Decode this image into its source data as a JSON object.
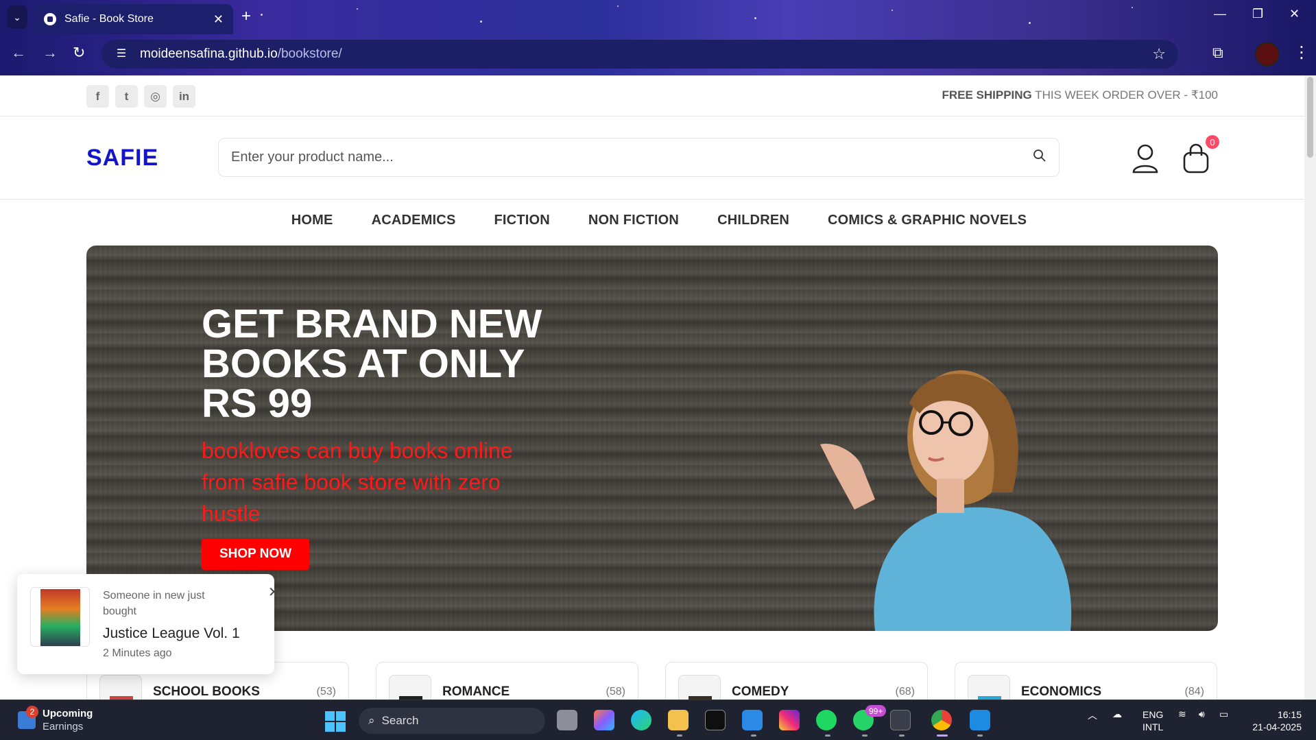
{
  "browser": {
    "tab_title": "Safie - Book Store",
    "url_host": "moideensafina.github.io",
    "url_path": "/bookstore/"
  },
  "topbar": {
    "socials": [
      "facebook-icon",
      "twitter-icon",
      "instagram-icon",
      "linkedin-icon"
    ],
    "shipping_bold": "FREE SHIPPING",
    "shipping_rest": " THIS WEEK ORDER OVER - ₹100"
  },
  "header": {
    "logo": "SAFIE",
    "search_placeholder": "Enter your product name...",
    "cart_count": "0"
  },
  "nav": {
    "items": [
      "HOME",
      "ACADEMICS",
      "FICTION",
      "NON FICTION",
      "CHILDREN",
      "COMICS & GRAPHIC NOVELS"
    ]
  },
  "hero": {
    "title": "GET BRAND NEW BOOKS AT ONLY RS 99",
    "subtitle": "bookloves can buy books online from safie book store with zero hustle",
    "button": "SHOP NOW",
    "colors": {
      "subtitle": "#ff1a1a",
      "button": "#ff0000"
    }
  },
  "categories": [
    {
      "name": "SCHOOL BOOKS",
      "count": "(53)"
    },
    {
      "name": "ROMANCE",
      "count": "(58)"
    },
    {
      "name": "COMEDY",
      "count": "(68)"
    },
    {
      "name": "ECONOMICS",
      "count": "(84)"
    }
  ],
  "toast": {
    "message": "Someone in new just bought",
    "product": "Justice League Vol. 1",
    "time": "2 Minutes ago"
  },
  "taskbar": {
    "widget_title": "Upcoming",
    "widget_sub": "Earnings",
    "widget_badge": "2",
    "search": "Search",
    "whatsapp_badge": "99+",
    "lang_1": "ENG",
    "lang_2": "INTL",
    "time": "16:15",
    "date": "21-04-2025"
  },
  "colors": {
    "brand": "#1414c8",
    "accent": "#ff0000"
  }
}
